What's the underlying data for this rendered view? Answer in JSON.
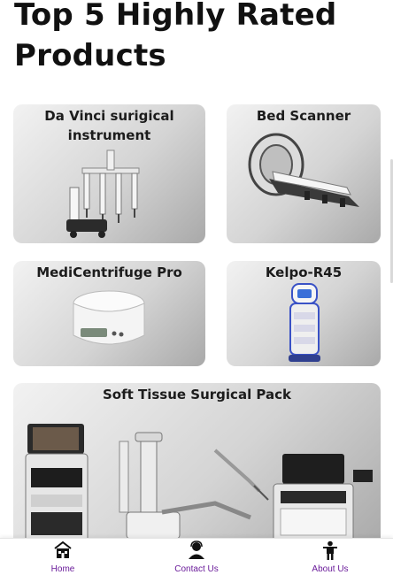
{
  "page": {
    "title": "Top 5 Highly Rated Products"
  },
  "products": [
    {
      "name": "Da Vinci surigical instrument",
      "image": "surgical-robot-image"
    },
    {
      "name": "Bed Scanner",
      "image": "mri-bed-scanner-image"
    },
    {
      "name": "MediCentrifuge Pro",
      "image": "centrifuge-image"
    },
    {
      "name": "Kelpo-R45",
      "image": "service-robot-image"
    },
    {
      "name": "Soft Tissue Surgical Pack",
      "image": "surgical-system-pack-image"
    }
  ],
  "bottom_nav": {
    "items": [
      {
        "label": "Home",
        "icon": "home-icon"
      },
      {
        "label": "Contact Us",
        "icon": "contact-icon"
      },
      {
        "label": "About Us",
        "icon": "person-icon"
      }
    ],
    "label_color": "#6a1b9a"
  }
}
